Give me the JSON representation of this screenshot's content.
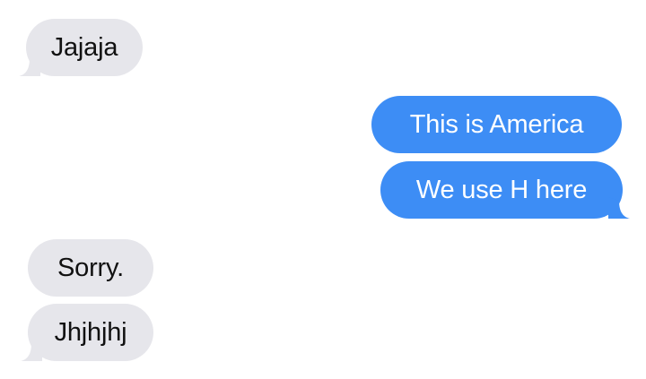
{
  "messages": [
    {
      "id": "jajaja",
      "direction": "received",
      "text": "Jajaja",
      "tail": true
    },
    {
      "id": "america",
      "direction": "sent",
      "text": "This is America",
      "tail": false
    },
    {
      "id": "weuse",
      "direction": "sent",
      "text": "We use H here",
      "tail": true
    },
    {
      "id": "sorry",
      "direction": "received",
      "text": "Sorry.",
      "tail": false
    },
    {
      "id": "jhjhjhj",
      "direction": "received",
      "text": "Jhjhjhj",
      "tail": true
    }
  ],
  "colors": {
    "received_bubble": "#e6e6eb",
    "received_text": "#111111",
    "sent_bubble": "#3d8df5",
    "sent_text": "#ffffff",
    "background": "#ffffff"
  }
}
